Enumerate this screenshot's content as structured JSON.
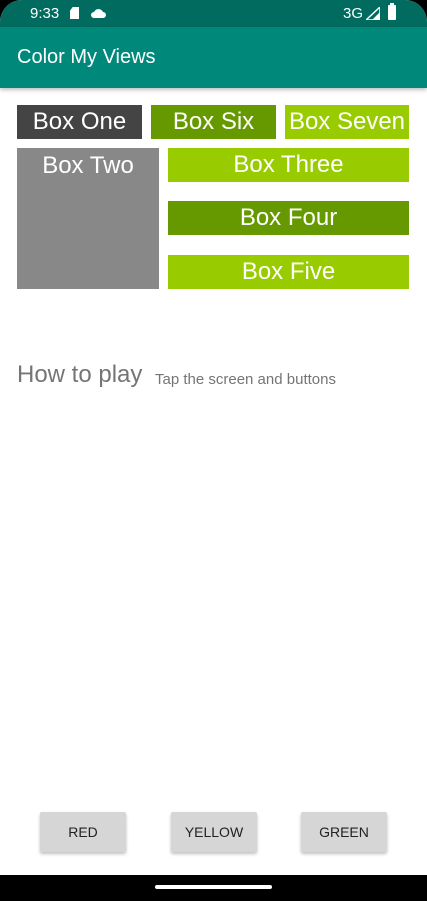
{
  "status_bar": {
    "time": "9:33",
    "network": "3G",
    "icons": [
      "sd-card-icon",
      "cloud-icon",
      "signal-icon",
      "battery-icon"
    ]
  },
  "app_bar": {
    "title": "Color My Views"
  },
  "boxes": {
    "one": "Box One",
    "two": "Box Two",
    "three": "Box Three",
    "four": "Box Four",
    "five": "Box Five",
    "six": "Box Six",
    "seven": "Box Seven"
  },
  "colors": {
    "status_bar": "#006b5e",
    "app_bar": "#00897b",
    "dark_gray": "#444444",
    "gray": "#888888",
    "dark_green": "#669900",
    "light_green": "#99cc00"
  },
  "how_to": {
    "label": "How to play",
    "text": "Tap the screen and buttons"
  },
  "buttons": {
    "red": "RED",
    "yellow": "YELLOW",
    "green": "GREEN"
  }
}
